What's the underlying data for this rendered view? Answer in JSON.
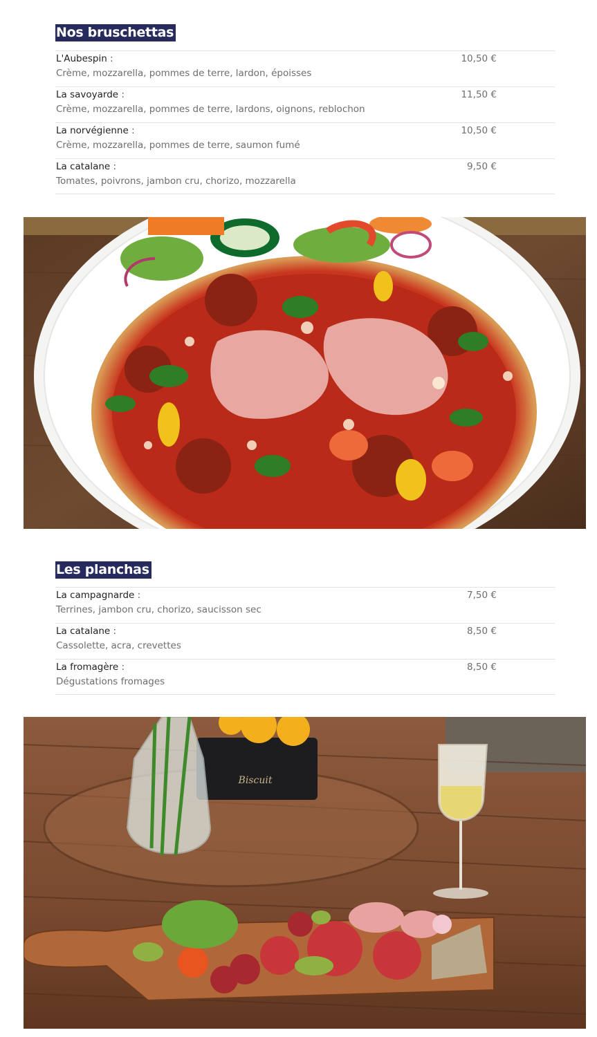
{
  "bruschettas": {
    "title": "Nos bruschettas",
    "items": [
      {
        "name": "L'Aubespin",
        "desc": "Crème, mozzarella, pommes de terre, lardon, époisses",
        "price": "10,50 €"
      },
      {
        "name": "La savoyarde",
        "desc": "Crème, mozzarella, pommes de terre, lardons, oignons, reblochon",
        "price": "11,50 €"
      },
      {
        "name": "La norvégienne",
        "desc": "Crème, mozzarella, pommes de terre, saumon fumé",
        "price": "10,50 €"
      },
      {
        "name": "La catalane",
        "desc": "Tomates, poivrons, jambon cru, chorizo, mozzarella",
        "price": "9,50 €"
      }
    ]
  },
  "planchas": {
    "title": "Les planchas",
    "items": [
      {
        "name": "La campagnarde",
        "desc": "Terrines, jambon cru, chorizo, saucisson sec",
        "price": "7,50 €"
      },
      {
        "name": "La catalane",
        "desc": "Cassolette, acra, crevettes",
        "price": "8,50 €"
      },
      {
        "name": "La fromagère",
        "desc": "Dégustations fromages",
        "price": "8,50 €"
      }
    ]
  },
  "common": {
    "colon": " :"
  },
  "photos": {
    "bruschetta_photo": {
      "icon": "bruschetta-photo"
    },
    "plancha_photo": {
      "icon": "plancha-photo"
    }
  }
}
